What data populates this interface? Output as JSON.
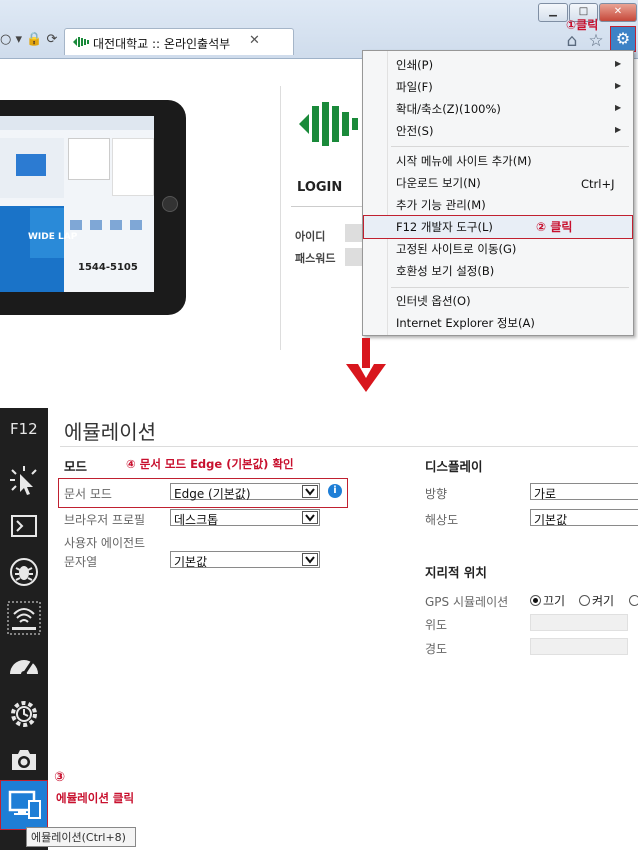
{
  "browser": {
    "window_buttons": [
      "▁",
      "□",
      "✕"
    ],
    "nav_icons": "○ ▾ 🔒 ⟳",
    "tab": {
      "title": "대전대학교 :: 온라인출석부",
      "close": "✕"
    },
    "toolbar": {
      "home_icon": "home-icon",
      "star_icon": "star-icon",
      "gear_icon": "gear-icon"
    },
    "page": {
      "login_title": "LOGIN",
      "id_label": "아이디",
      "pw_label": "패스워드",
      "tablet_banner": "WIDE LAP",
      "tablet_phone": "1544-5105",
      "tablet_text": "!"
    }
  },
  "menu": {
    "items": [
      {
        "label": "인쇄(P)",
        "submenu": true
      },
      {
        "label": "파일(F)",
        "submenu": true
      },
      {
        "label": "확대/축소(Z)(100%)",
        "submenu": true
      },
      {
        "label": "안전(S)",
        "submenu": true
      },
      {
        "label": "시작 메뉴에 사이트 추가(M)"
      },
      {
        "label": "다운로드 보기(N)",
        "shortcut": "Ctrl+J"
      },
      {
        "label": "추가 기능 관리(M)"
      },
      {
        "label": "F12 개발자 도구(L)",
        "highlighted": true
      },
      {
        "label": "고정된 사이트로 이동(G)"
      },
      {
        "label": "호환성 보기 설정(B)"
      },
      {
        "label": "인터넷 옵션(O)"
      },
      {
        "label": "Internet Explorer 정보(A)"
      }
    ]
  },
  "annotations": {
    "step1": "①클릭",
    "step2": "② 클릭",
    "step3_num": "③",
    "step3": "에뮬레이션 클릭",
    "step4": "④ 문서 모드 Edge (기본값) 확인"
  },
  "devtools": {
    "label": "F12",
    "tooltip": "에뮬레이션(Ctrl+8)",
    "title": "에뮬레이션",
    "mode": {
      "heading": "모드",
      "doc_mode_label": "문서 모드",
      "doc_mode_value": "Edge (기본값)",
      "browser_profile_label": "브라우저 프로필",
      "browser_profile_value": "데스크톱",
      "ua_label_line1": "사용자 에이전트",
      "ua_label_line2": "문자열",
      "ua_value": "기본값"
    },
    "display": {
      "heading": "디스플레이",
      "orientation_label": "방향",
      "orientation_value": "가로",
      "resolution_label": "해상도",
      "resolution_value": "기본값"
    },
    "geo": {
      "heading": "지리적 위치",
      "gps_label": "GPS 시뮬레이션",
      "gps_off": "끄기",
      "gps_on": "켜기",
      "lat_label": "위도",
      "lon_label": "경도"
    }
  },
  "colors": {
    "annotation": "#c8102e",
    "accent": "#1e7ed6",
    "sidebar": "#1f1f1f"
  }
}
